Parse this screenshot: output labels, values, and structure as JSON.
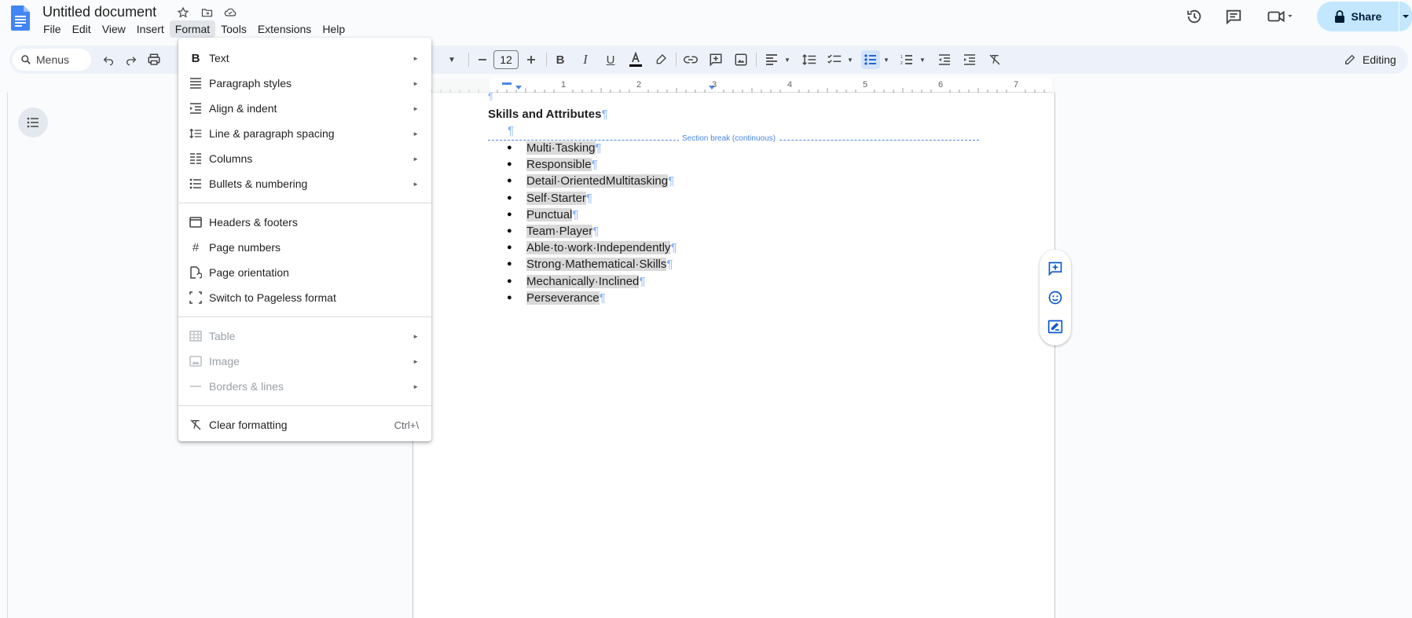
{
  "title_bar": {
    "doc_title": "Untitled document",
    "menus": [
      "File",
      "Edit",
      "View",
      "Insert",
      "Format",
      "Tools",
      "Extensions",
      "Help"
    ],
    "active_menu": "Format",
    "share_label": "Share"
  },
  "toolbar": {
    "search_label": "Menus",
    "font_size": "12",
    "mode_label": "Editing"
  },
  "format_menu": {
    "groups": [
      [
        {
          "label": "Text",
          "icon": "bold-icon",
          "submenu": true
        },
        {
          "label": "Paragraph styles",
          "icon": "paragraph-styles-icon",
          "submenu": true
        },
        {
          "label": "Align & indent",
          "icon": "align-indent-icon",
          "submenu": true
        },
        {
          "label": "Line & paragraph spacing",
          "icon": "line-spacing-icon",
          "submenu": true
        },
        {
          "label": "Columns",
          "icon": "columns-icon",
          "submenu": true
        },
        {
          "label": "Bullets & numbering",
          "icon": "bullets-icon",
          "submenu": true
        }
      ],
      [
        {
          "label": "Headers & footers",
          "icon": "header-footer-icon"
        },
        {
          "label": "Page numbers",
          "icon": "hash-icon"
        },
        {
          "label": "Page orientation",
          "icon": "page-orientation-icon"
        },
        {
          "label": "Switch to Pageless format",
          "icon": "pageless-icon"
        }
      ],
      [
        {
          "label": "Table",
          "icon": "table-icon",
          "submenu": true,
          "disabled": true
        },
        {
          "label": "Image",
          "icon": "image-icon",
          "submenu": true,
          "disabled": true
        },
        {
          "label": "Borders & lines",
          "icon": "borders-icon",
          "submenu": true,
          "disabled": true
        }
      ],
      [
        {
          "label": "Clear formatting",
          "icon": "clear-format-icon",
          "shortcut": "Ctrl+\\"
        }
      ]
    ]
  },
  "document": {
    "pilcrow": "¶",
    "heading": "Skills and Attributes",
    "section_break_label": "Section break (continuous)",
    "bullets": [
      "Multi·Tasking",
      "Responsible",
      "Detail·OrientedMultitasking",
      "Self·Starter",
      "Punctual",
      "Team·Player",
      "Able·to·work·Independently",
      "Strong·Mathematical·Skills",
      "Mechanically·Inclined",
      "Perseverance"
    ]
  },
  "ruler": {
    "numbers": [
      "1",
      "2",
      "3",
      "4",
      "5",
      "6",
      "7"
    ]
  }
}
